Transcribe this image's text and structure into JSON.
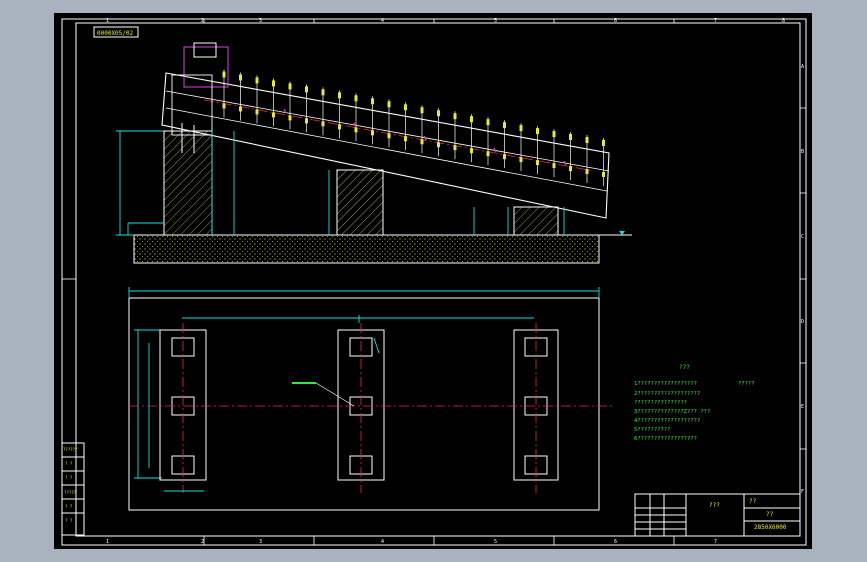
{
  "drawing": {
    "frame_code": "0000X05/02",
    "border_numbers": [
      "1",
      "2",
      "3",
      "4",
      "5",
      "6",
      "7",
      "8"
    ],
    "border_letters": [
      "A",
      "B",
      "C",
      "D",
      "E",
      "F"
    ],
    "title_block": {
      "name_label": "???",
      "scale_label": "??",
      "part_code": "2850X6000",
      "sheet": "??"
    },
    "tech_requirements": {
      "heading": "???",
      "lines": [
        "1??????????????????",
        "2???????????????????",
        "  ????????????????",
        "3??????????????Z??? ???",
        "4???????????????????",
        "5??????????",
        "6??????????????????"
      ],
      "side_note": "?????"
    },
    "left_table": {
      "rows": [
        "??????",
        "? ?",
        "? ?",
        "?????",
        "? ?",
        "? ?"
      ]
    },
    "colors": {
      "frame": "#ffffff",
      "dimension": "#19e0e0",
      "text_yellow": "#e8e83c",
      "text_green": "#39e83c",
      "centerline": "#e0303a",
      "machine_magenta": "#e040e0"
    }
  }
}
